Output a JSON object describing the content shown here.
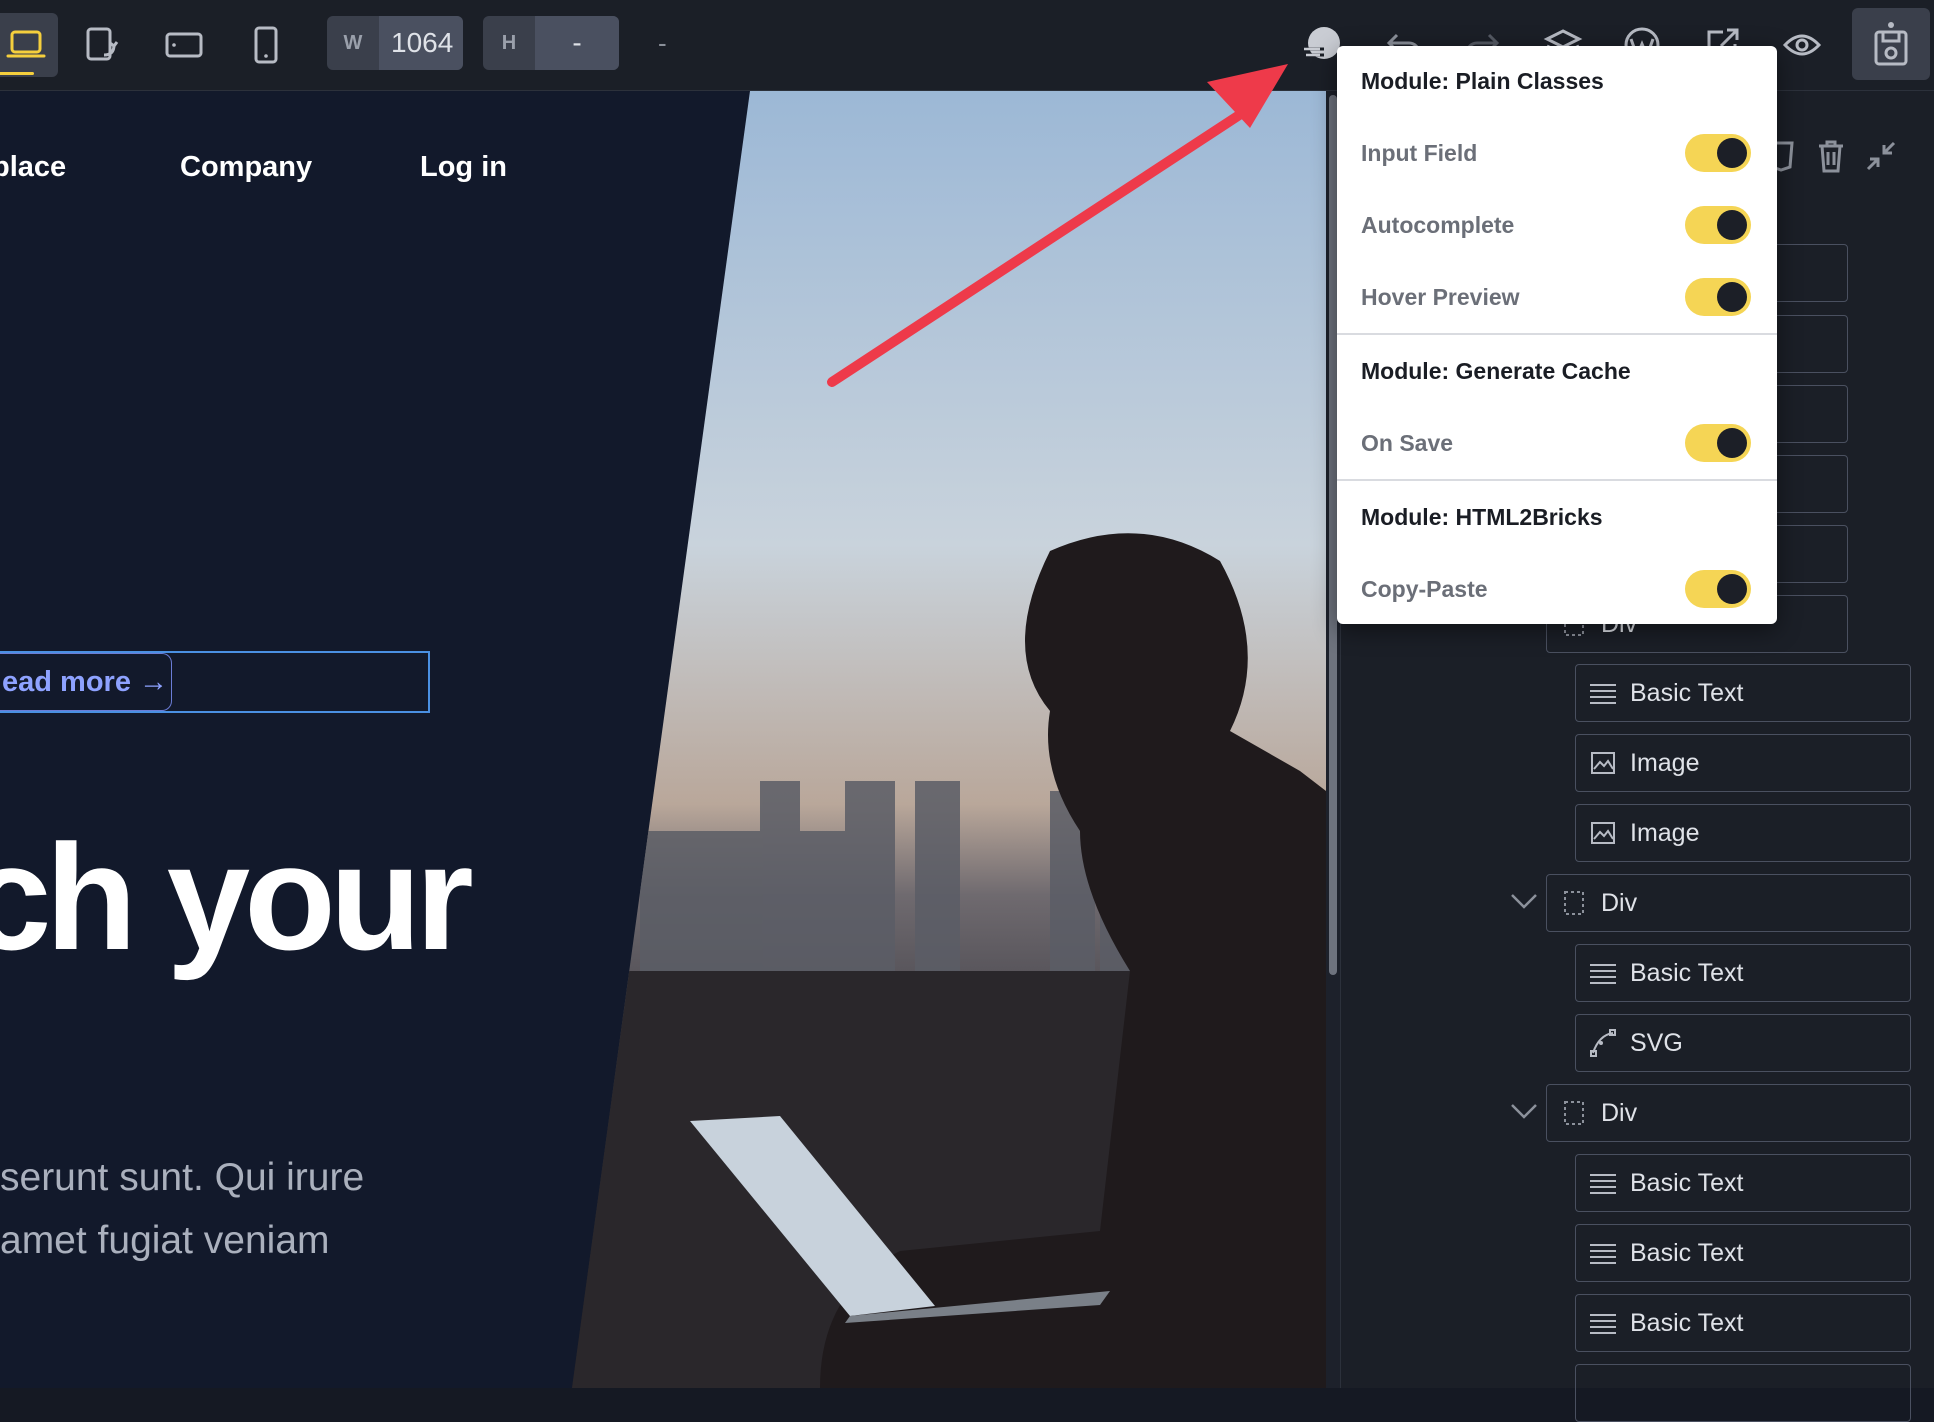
{
  "toolbar": {
    "width_label": "W",
    "width_value": "1064",
    "height_label": "H",
    "height_value": "-",
    "dash": "-",
    "accent": "#f5cf3d"
  },
  "canvas": {
    "nav": [
      "place",
      "Company",
      "Log in"
    ],
    "read_more": "ead more →",
    "headline": "ch your",
    "paragraph_lines": [
      "serunt sunt. Qui irure",
      "amet fugiat veniam"
    ],
    "background": "#12192b"
  },
  "popup": {
    "sections": [
      {
        "title": "Module: Plain Classes",
        "toggles": [
          {
            "label": "Input Field",
            "on": true
          },
          {
            "label": "Autocomplete",
            "on": true
          },
          {
            "label": "Hover Preview",
            "on": true
          }
        ]
      },
      {
        "title": "Module: Generate Cache",
        "toggles": [
          {
            "label": "On Save",
            "on": true
          }
        ]
      },
      {
        "title": "Module: HTML2Bricks",
        "toggles": [
          {
            "label": "Copy-Paste",
            "on": true
          }
        ]
      }
    ],
    "toggle_color": "#f5d555"
  },
  "structure": {
    "partial_label": "Div",
    "items": [
      {
        "label": "Basic Text",
        "icon": "text-lines-icon"
      },
      {
        "label": "Image",
        "icon": "image-icon"
      },
      {
        "label": "Image",
        "icon": "image-icon"
      },
      {
        "label": "Div",
        "icon": "div-box-icon"
      },
      {
        "label": "Basic Text",
        "icon": "text-lines-icon"
      },
      {
        "label": "SVG",
        "icon": "svg-pen-icon"
      },
      {
        "label": "Div",
        "icon": "div-box-icon"
      },
      {
        "label": "Basic Text",
        "icon": "text-lines-icon"
      },
      {
        "label": "Basic Text",
        "icon": "text-lines-icon"
      },
      {
        "label": "Basic Text",
        "icon": "text-lines-icon"
      }
    ]
  },
  "annotation": {
    "arrow_color": "#ee3a4a"
  }
}
